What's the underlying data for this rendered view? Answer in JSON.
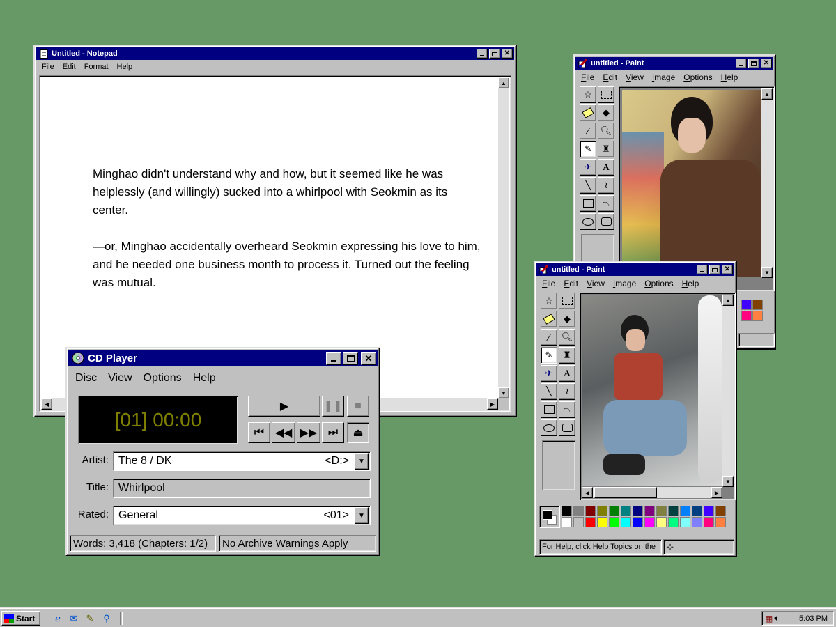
{
  "notepad": {
    "title": "Untitled - Notepad",
    "menu": [
      "File",
      "Edit",
      "Format",
      "Help"
    ],
    "paragraphs": [
      "Minghao didn't understand why and how, but it seemed like he was helplessly (and willingly) sucked into a whirlpool with Seokmin as its center.",
      "—or, Minghao accidentally overheard Seokmin expressing his love to him, and he needed one business month to process it. Turned out the feeling was mutual."
    ]
  },
  "cdplayer": {
    "title": "CD Player",
    "menu": [
      "Disc",
      "View",
      "Options",
      "Help"
    ],
    "display": "[01] 00:00",
    "artist_label": "Artist:",
    "artist_value": "The 8 / DK",
    "drive": "<D:>",
    "title_label": "Title:",
    "title_value": "Whirlpool",
    "rated_label": "Rated:",
    "rated_value": "General",
    "rated_track": "<01>",
    "status_words": "Words:  3,418 (Chapters: 1/2)",
    "status_warning": "No Archive Warnings Apply",
    "display_color": "#808000"
  },
  "paint_back": {
    "title": "untitled - Paint",
    "menu": [
      "File",
      "Edit",
      "View",
      "Image",
      "Options",
      "Help"
    ]
  },
  "paint_front": {
    "title": "untitled - Paint",
    "menu": [
      "File",
      "Edit",
      "View",
      "Image",
      "Options",
      "Help"
    ],
    "status": "For Help, click Help Topics on the"
  },
  "palette": [
    "#000000",
    "#808080",
    "#800000",
    "#808000",
    "#008000",
    "#008080",
    "#000080",
    "#800080",
    "#808040",
    "#004040",
    "#0080ff",
    "#004080",
    "#4000ff",
    "#804000",
    "#ffffff",
    "#c0c0c0",
    "#ff0000",
    "#ffff00",
    "#00ff00",
    "#00ffff",
    "#0000ff",
    "#ff00ff",
    "#ffff80",
    "#00ff80",
    "#80ffff",
    "#8080ff",
    "#ff0080",
    "#ff8040"
  ],
  "taskbar": {
    "start_label": "Start",
    "clock": "5:03 PM"
  }
}
